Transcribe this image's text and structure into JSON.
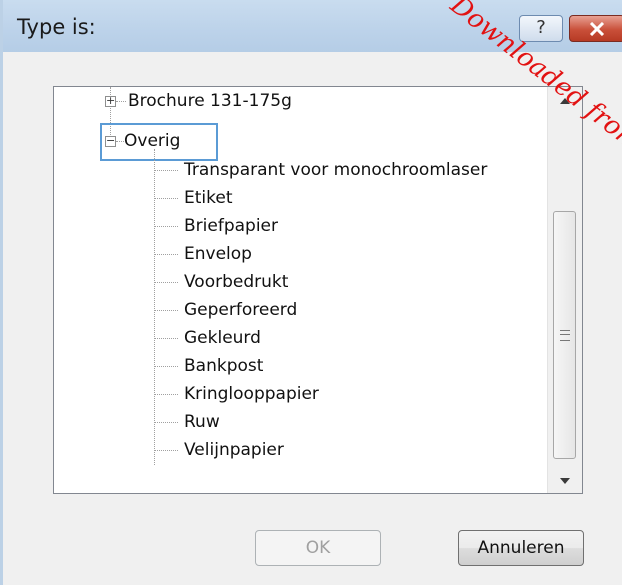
{
  "dialog": {
    "title": "Type is:",
    "help_label": "?",
    "close_label": "x"
  },
  "watermark": "Downloaded from www.vandenborre.be",
  "tree": {
    "nodes": [
      {
        "label": "Brochure 131-175g",
        "state": "collapsed"
      },
      {
        "label": "Overig",
        "state": "expanded",
        "focused": true
      }
    ],
    "children": [
      "Transparant voor monochroomlaser",
      "Etiket",
      "Briefpapier",
      "Envelop",
      "Voorbedrukt",
      "Geperforeerd",
      "Gekleurd",
      "Bankpost",
      "Kringlooppapier",
      "Ruw",
      "Velijnpapier"
    ]
  },
  "scrollbar": {
    "up_icon": "chevron-up",
    "down_icon": "chevron-down",
    "position": 0.55
  },
  "buttons": {
    "ok": "OK",
    "cancel": "Annuleren",
    "ok_enabled": false
  }
}
